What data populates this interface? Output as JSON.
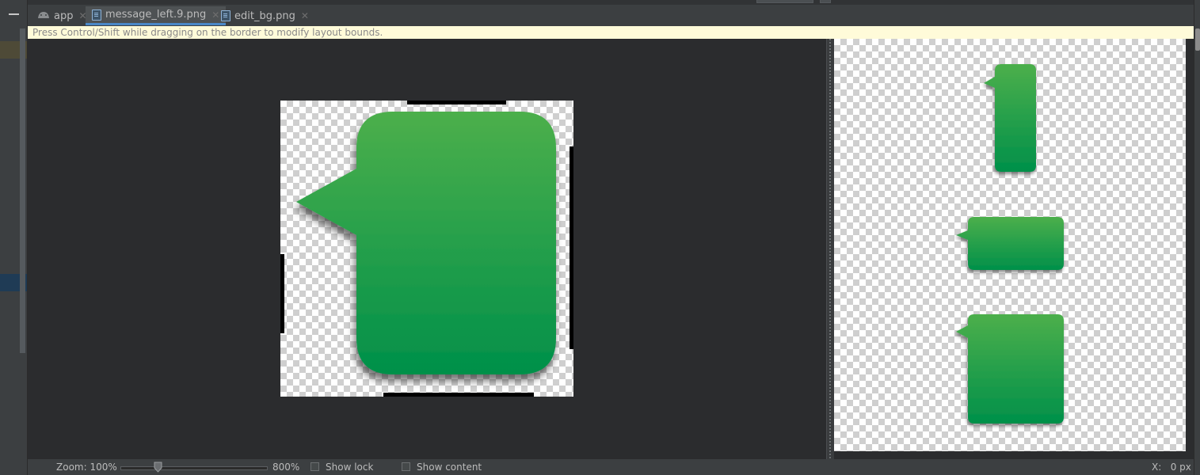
{
  "tabs": [
    {
      "label": "app",
      "icon": "android-icon",
      "active": false
    },
    {
      "label": "message_left.9.png",
      "icon": "image-file-icon",
      "active": true
    },
    {
      "label": "edit_bg.png",
      "icon": "image-file-icon",
      "active": false
    }
  ],
  "hint": "Press Control/Shift while dragging on the border to modify layout bounds.",
  "status": {
    "zoom_label": "Zoom: 100%",
    "zoom_max": "800%",
    "show_lock": "Show lock",
    "show_content": "Show content",
    "coord": "X:   0 px"
  },
  "colors": {
    "bubble_top": "#4caf50",
    "bubble_bottom": "#00904a",
    "accent": "#4a88c7"
  }
}
